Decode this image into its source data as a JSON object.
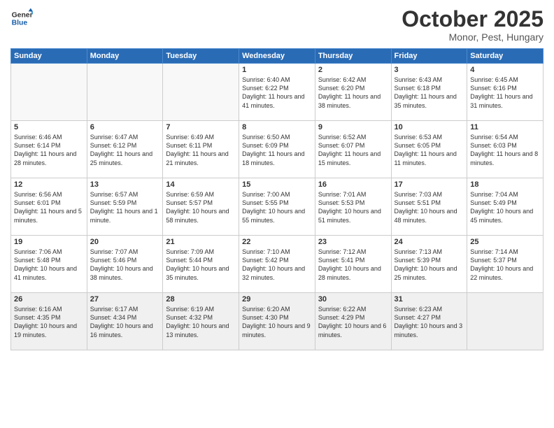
{
  "logo": {
    "line1": "General",
    "line2": "Blue"
  },
  "title": "October 2025",
  "subtitle": "Monor, Pest, Hungary",
  "header_days": [
    "Sunday",
    "Monday",
    "Tuesday",
    "Wednesday",
    "Thursday",
    "Friday",
    "Saturday"
  ],
  "weeks": [
    [
      {
        "day": "",
        "info": ""
      },
      {
        "day": "",
        "info": ""
      },
      {
        "day": "",
        "info": ""
      },
      {
        "day": "1",
        "info": "Sunrise: 6:40 AM\nSunset: 6:22 PM\nDaylight: 11 hours\nand 41 minutes."
      },
      {
        "day": "2",
        "info": "Sunrise: 6:42 AM\nSunset: 6:20 PM\nDaylight: 11 hours\nand 38 minutes."
      },
      {
        "day": "3",
        "info": "Sunrise: 6:43 AM\nSunset: 6:18 PM\nDaylight: 11 hours\nand 35 minutes."
      },
      {
        "day": "4",
        "info": "Sunrise: 6:45 AM\nSunset: 6:16 PM\nDaylight: 11 hours\nand 31 minutes."
      }
    ],
    [
      {
        "day": "5",
        "info": "Sunrise: 6:46 AM\nSunset: 6:14 PM\nDaylight: 11 hours\nand 28 minutes."
      },
      {
        "day": "6",
        "info": "Sunrise: 6:47 AM\nSunset: 6:12 PM\nDaylight: 11 hours\nand 25 minutes."
      },
      {
        "day": "7",
        "info": "Sunrise: 6:49 AM\nSunset: 6:11 PM\nDaylight: 11 hours\nand 21 minutes."
      },
      {
        "day": "8",
        "info": "Sunrise: 6:50 AM\nSunset: 6:09 PM\nDaylight: 11 hours\nand 18 minutes."
      },
      {
        "day": "9",
        "info": "Sunrise: 6:52 AM\nSunset: 6:07 PM\nDaylight: 11 hours\nand 15 minutes."
      },
      {
        "day": "10",
        "info": "Sunrise: 6:53 AM\nSunset: 6:05 PM\nDaylight: 11 hours\nand 11 minutes."
      },
      {
        "day": "11",
        "info": "Sunrise: 6:54 AM\nSunset: 6:03 PM\nDaylight: 11 hours\nand 8 minutes."
      }
    ],
    [
      {
        "day": "12",
        "info": "Sunrise: 6:56 AM\nSunset: 6:01 PM\nDaylight: 11 hours\nand 5 minutes."
      },
      {
        "day": "13",
        "info": "Sunrise: 6:57 AM\nSunset: 5:59 PM\nDaylight: 11 hours\nand 1 minute."
      },
      {
        "day": "14",
        "info": "Sunrise: 6:59 AM\nSunset: 5:57 PM\nDaylight: 10 hours\nand 58 minutes."
      },
      {
        "day": "15",
        "info": "Sunrise: 7:00 AM\nSunset: 5:55 PM\nDaylight: 10 hours\nand 55 minutes."
      },
      {
        "day": "16",
        "info": "Sunrise: 7:01 AM\nSunset: 5:53 PM\nDaylight: 10 hours\nand 51 minutes."
      },
      {
        "day": "17",
        "info": "Sunrise: 7:03 AM\nSunset: 5:51 PM\nDaylight: 10 hours\nand 48 minutes."
      },
      {
        "day": "18",
        "info": "Sunrise: 7:04 AM\nSunset: 5:49 PM\nDaylight: 10 hours\nand 45 minutes."
      }
    ],
    [
      {
        "day": "19",
        "info": "Sunrise: 7:06 AM\nSunset: 5:48 PM\nDaylight: 10 hours\nand 41 minutes."
      },
      {
        "day": "20",
        "info": "Sunrise: 7:07 AM\nSunset: 5:46 PM\nDaylight: 10 hours\nand 38 minutes."
      },
      {
        "day": "21",
        "info": "Sunrise: 7:09 AM\nSunset: 5:44 PM\nDaylight: 10 hours\nand 35 minutes."
      },
      {
        "day": "22",
        "info": "Sunrise: 7:10 AM\nSunset: 5:42 PM\nDaylight: 10 hours\nand 32 minutes."
      },
      {
        "day": "23",
        "info": "Sunrise: 7:12 AM\nSunset: 5:41 PM\nDaylight: 10 hours\nand 28 minutes."
      },
      {
        "day": "24",
        "info": "Sunrise: 7:13 AM\nSunset: 5:39 PM\nDaylight: 10 hours\nand 25 minutes."
      },
      {
        "day": "25",
        "info": "Sunrise: 7:14 AM\nSunset: 5:37 PM\nDaylight: 10 hours\nand 22 minutes."
      }
    ],
    [
      {
        "day": "26",
        "info": "Sunrise: 6:16 AM\nSunset: 4:35 PM\nDaylight: 10 hours\nand 19 minutes."
      },
      {
        "day": "27",
        "info": "Sunrise: 6:17 AM\nSunset: 4:34 PM\nDaylight: 10 hours\nand 16 minutes."
      },
      {
        "day": "28",
        "info": "Sunrise: 6:19 AM\nSunset: 4:32 PM\nDaylight: 10 hours\nand 13 minutes."
      },
      {
        "day": "29",
        "info": "Sunrise: 6:20 AM\nSunset: 4:30 PM\nDaylight: 10 hours\nand 9 minutes."
      },
      {
        "day": "30",
        "info": "Sunrise: 6:22 AM\nSunset: 4:29 PM\nDaylight: 10 hours\nand 6 minutes."
      },
      {
        "day": "31",
        "info": "Sunrise: 6:23 AM\nSunset: 4:27 PM\nDaylight: 10 hours\nand 3 minutes."
      },
      {
        "day": "",
        "info": ""
      }
    ]
  ]
}
